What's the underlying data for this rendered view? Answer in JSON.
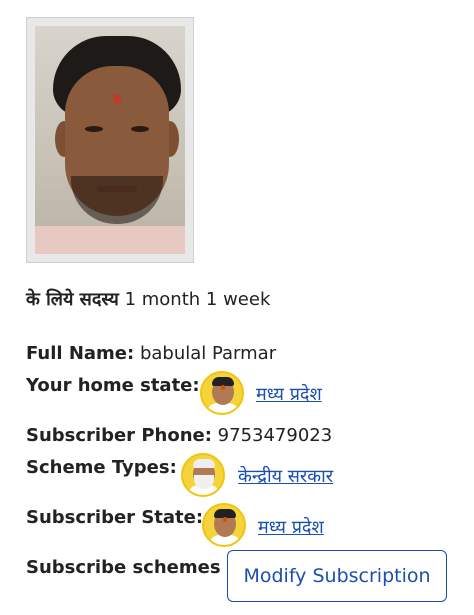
{
  "membership": {
    "label": "के लिये सदस्य",
    "duration": "1 month 1 week"
  },
  "fields": {
    "full_name_label": "Full Name:",
    "full_name_value": "babulal Parmar",
    "home_state_label": "Your home state:",
    "home_state_value": "मध्य प्रदेश",
    "phone_label": "Subscriber Phone:",
    "phone_value": "9753479023",
    "scheme_types_label": "Scheme Types:",
    "scheme_types_value": "केन्द्रीय सरकार",
    "subscriber_state_label": "Subscriber State:",
    "subscriber_state_value": "मध्य प्रदेश",
    "subscribe_schemes_label": "Subscribe schemes"
  },
  "actions": {
    "modify_label": "Modify Subscription"
  },
  "colors": {
    "link": "#1a4fb0",
    "avatar_ring": "#f1c40f"
  }
}
